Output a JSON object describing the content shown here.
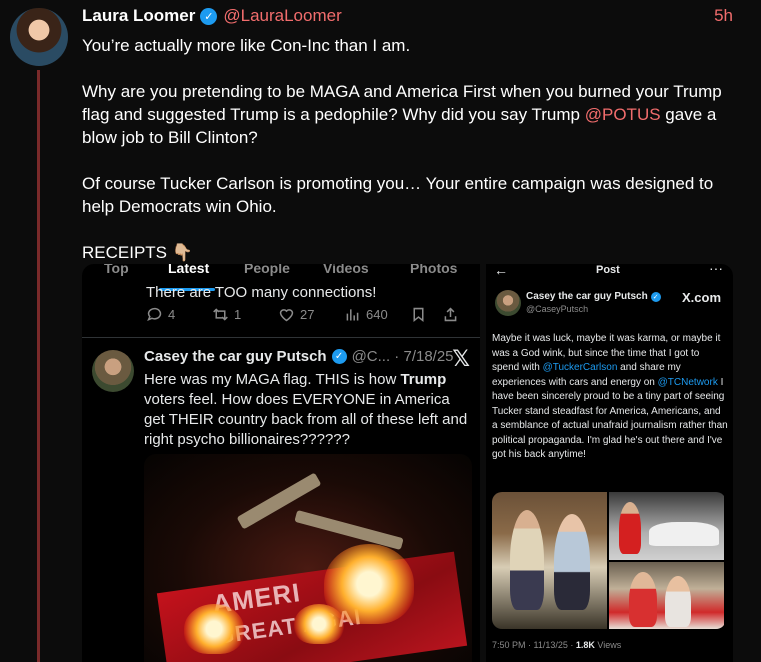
{
  "post": {
    "author_name": "Laura Loomer",
    "author_handle": "@LauraLoomer",
    "time": "5h",
    "paragraph1": "You’re actually more like Con-Inc than I am.",
    "paragraph2_a": "Why are you pretending to be MAGA and America First when you burned your Trump flag and suggested Trump is a pedophile? Why did you say Trump ",
    "paragraph2_mention": "@POTUS",
    "paragraph2_b": " gave a blow job to Bill Clinton?",
    "paragraph3": "Of course Tucker Carlson is promoting you… Your entire campaign was designed to help Democrats win Ohio.",
    "paragraph4": "RECEIPTS 👇🏼"
  },
  "left_media": {
    "tabs": [
      "Top",
      "Latest",
      "People",
      "Videos",
      "Photos"
    ],
    "cut_text": "There are TOO many connections!",
    "actions": {
      "replies": "4",
      "reposts": "1",
      "likes": "27",
      "views": "640"
    },
    "inner_name": "Casey the car guy Putsch",
    "inner_meta": "@C... · 7/18/25",
    "inner_text_a": "Here was my MAGA flag. THIS is how ",
    "inner_text_bold": "Trump",
    "inner_text_b": " voters feel. How does EVERYONE in America get THEIR country back from all of these left and right psycho billionaires??????",
    "flag_text_line1": "AMERI",
    "flag_text_line2": "GREAT AGAI"
  },
  "right_media": {
    "title": "Post",
    "name": "Casey the car guy Putsch",
    "handle": "@CaseyPutsch",
    "xcom": "X.com",
    "text_a": "Maybe it was luck, maybe it was karma, or maybe it was a God wink, but since the time that I got to spend with ",
    "mention1": "@TuckerCarlson",
    "text_b": " and share my experiences with cars and energy on ",
    "mention2": "@TCNetwork",
    "text_c": " I have been sincerely proud to be a tiny part of seeing Tucker stand steadfast for America, Americans, and a semblance of actual unafraid journalism rather than political propaganda. I'm glad he's out there and I've got his back anytime!",
    "footer_time": "7:50 PM · 11/13/25 · ",
    "footer_views": "1.8K",
    "footer_views_label": " Views"
  },
  "colors": {
    "accent": "#f26d6d",
    "twitter_blue": "#1d9bf0",
    "background": "#0c0c0c"
  }
}
